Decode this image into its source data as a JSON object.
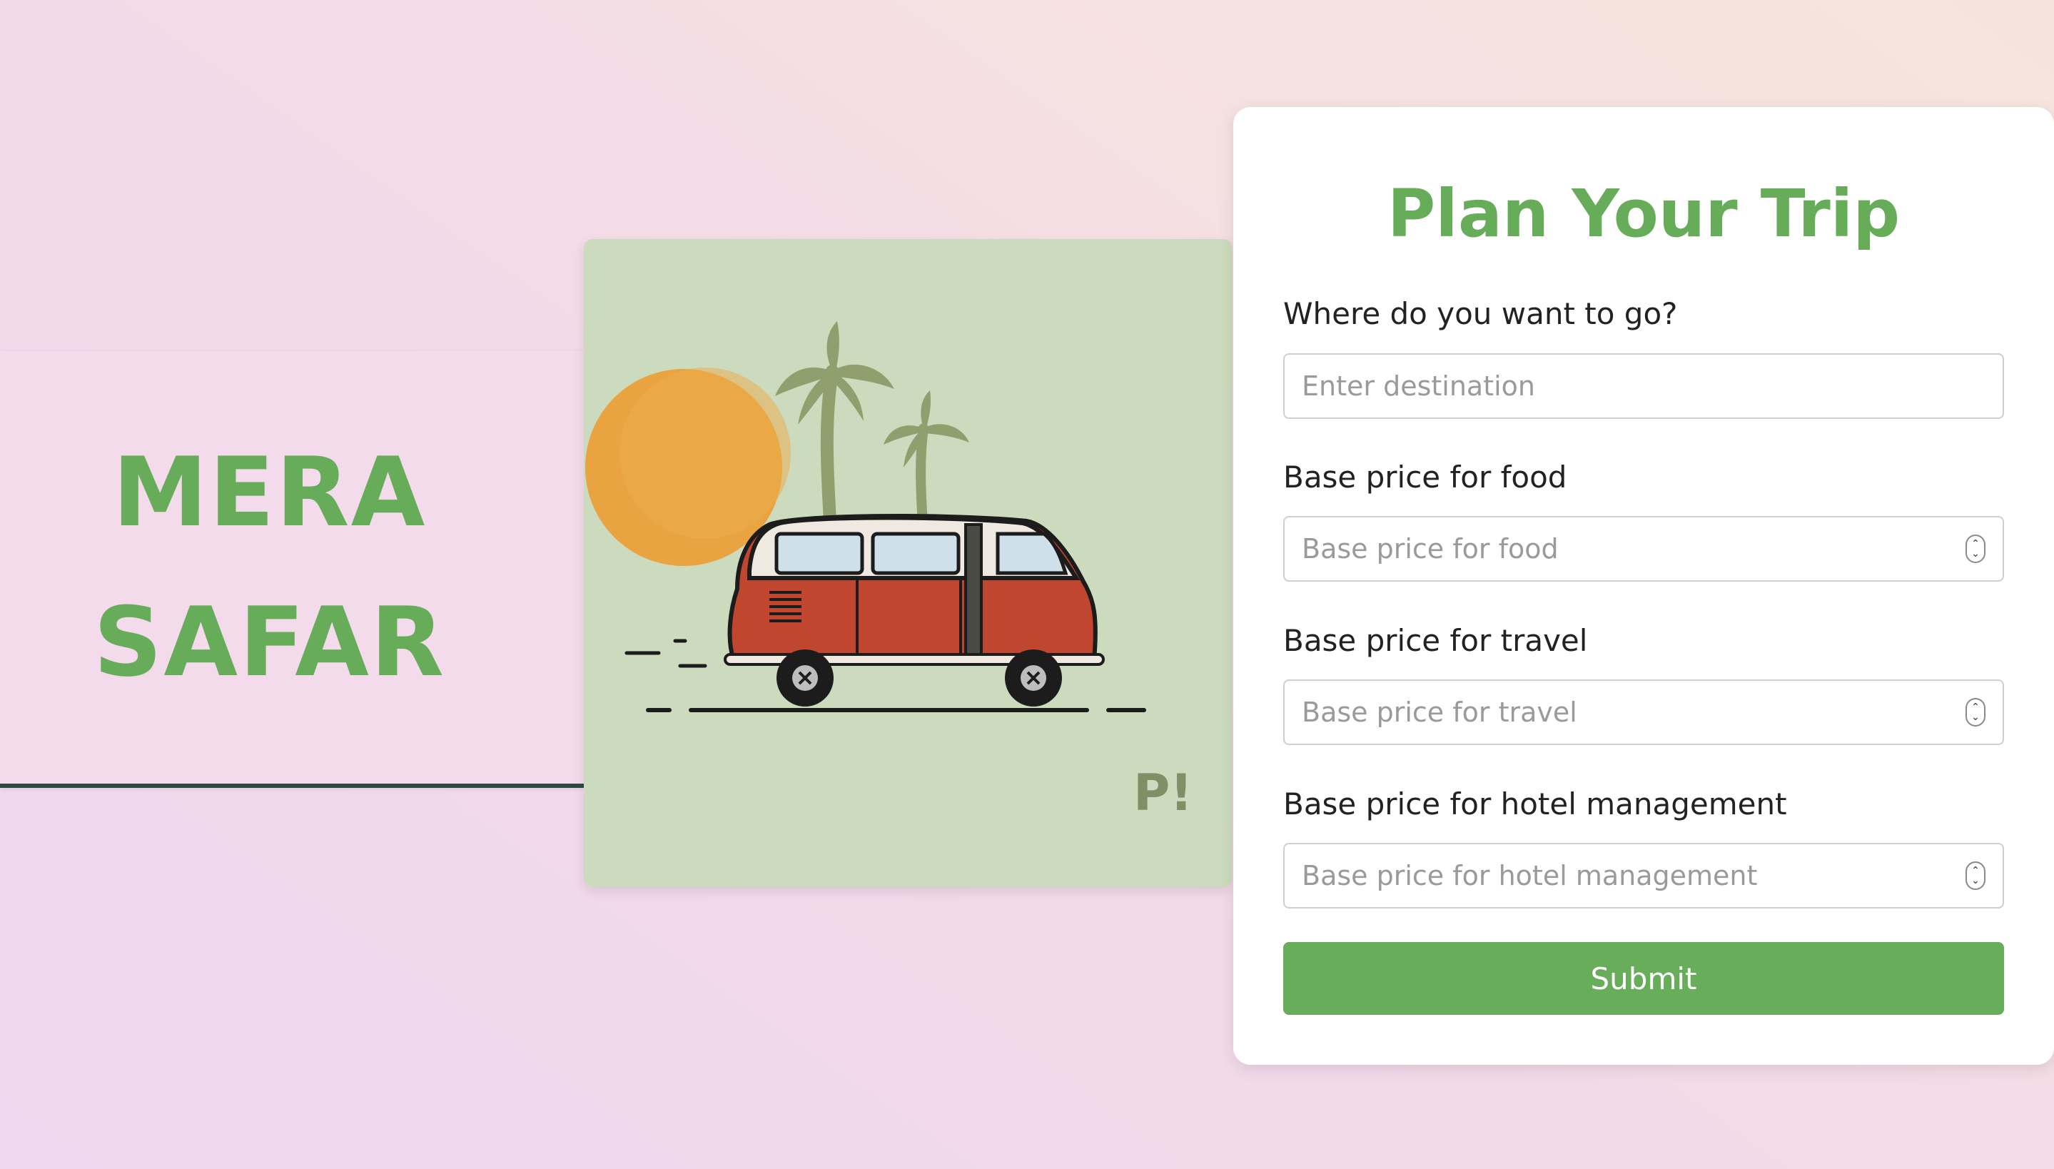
{
  "brand": {
    "line1": "MERA",
    "line2": "SAFAR",
    "color": "#66ac59"
  },
  "illustration": {
    "description_icon": "camper-van-illustration",
    "signature": "P!"
  },
  "form": {
    "title": "Plan Your Trip",
    "fields": [
      {
        "label": "Where do you want to go?",
        "placeholder": "Enter destination",
        "type": "text"
      },
      {
        "label": "Base price for food",
        "placeholder": "Base price for food",
        "type": "number"
      },
      {
        "label": "Base price for travel",
        "placeholder": "Base price for travel",
        "type": "number"
      },
      {
        "label": "Base price for hotel management",
        "placeholder": "Base price for hotel management",
        "type": "number"
      }
    ],
    "submit_label": "Submit"
  },
  "colors": {
    "accent": "#66ac59",
    "button": "#68ad5a",
    "band_border": "#2c4a42",
    "illustration_bg": "#ccdabd"
  }
}
